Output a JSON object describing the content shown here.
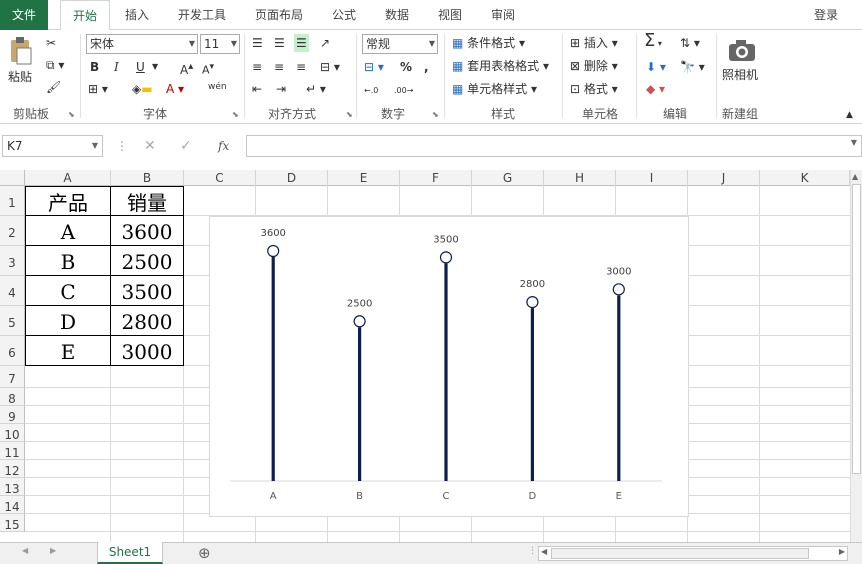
{
  "ribbon_tabs": [
    "文件",
    "开始",
    "插入",
    "开发工具",
    "页面布局",
    "公式",
    "数据",
    "视图",
    "审阅"
  ],
  "login_label": "登录",
  "clipboard": {
    "paste_label": "粘贴",
    "group_label": "剪贴板"
  },
  "font": {
    "name": "宋体",
    "size": "11",
    "group_label": "字体",
    "bold": "B",
    "italic": "I",
    "underline": "U",
    "grow": "A",
    "shrink": "A",
    "wen": "wén",
    "font_color": "A"
  },
  "alignment": {
    "group_label": "对齐方式"
  },
  "number": {
    "format": "常规",
    "group_label": "数字",
    "percent": "%",
    "comma": ","
  },
  "styles": {
    "conditional": "条件格式",
    "table": "套用表格格式",
    "cell": "单元格样式",
    "group_label": "样式"
  },
  "cells": {
    "insert": "插入",
    "delete": "删除",
    "format": "格式",
    "group_label": "单元格"
  },
  "editing": {
    "group_label": "编辑",
    "sigma": "Σ"
  },
  "camera": {
    "label": "照相机",
    "group_label": "新建组"
  },
  "name_box": "K7",
  "fx_label": "fx",
  "columns": [
    "A",
    "B",
    "C",
    "D",
    "E",
    "F",
    "G",
    "H",
    "I",
    "J",
    "K"
  ],
  "rows": [
    "1",
    "2",
    "3",
    "4",
    "5",
    "6",
    "7",
    "8",
    "9",
    "10",
    "11",
    "12",
    "13",
    "14",
    "15"
  ],
  "table": {
    "header": [
      "产品",
      "销量"
    ],
    "rows": [
      [
        "A",
        "3600"
      ],
      [
        "B",
        "2500"
      ],
      [
        "C",
        "3500"
      ],
      [
        "D",
        "2800"
      ],
      [
        "E",
        "3000"
      ]
    ]
  },
  "chart_data": {
    "type": "lollipop",
    "categories": [
      "A",
      "B",
      "C",
      "D",
      "E"
    ],
    "values": [
      3600,
      2500,
      3500,
      2800,
      3000
    ],
    "data_labels": [
      "3600",
      "2500",
      "3500",
      "2800",
      "3000"
    ],
    "title": "",
    "xlabel": "",
    "ylabel": "",
    "ylim": [
      0,
      4000
    ],
    "grid": false,
    "legend": "none",
    "stem_color": "#0d1f4f",
    "marker_fill": "#ffffff"
  },
  "sheet_tabs": [
    "Sheet1"
  ],
  "add_sheet": "⊕"
}
